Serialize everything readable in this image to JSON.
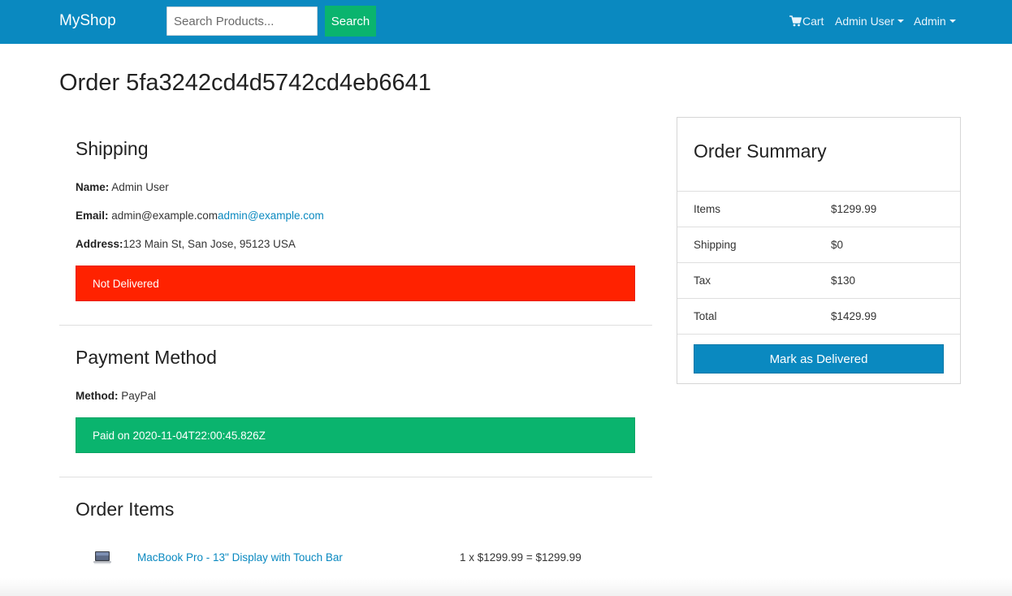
{
  "navbar": {
    "brand": "MyShop",
    "search_placeholder": "Search Products...",
    "search_button": "Search",
    "cart_label": "Cart",
    "cart_icon": "shopping-cart-icon",
    "user_menu": "Admin User",
    "admin_menu": "Admin"
  },
  "order": {
    "title": "Order 5fa3242cd4d5742cd4eb6641"
  },
  "shipping": {
    "heading": "Shipping",
    "name_label": "Name:",
    "name_value": "Admin User",
    "email_label": "Email:",
    "email_text": "admin@example.com",
    "email_link": "admin@example.com",
    "address_label": "Address:",
    "address_value": "123 Main St, San Jose, 95123 USA",
    "status": "Not Delivered"
  },
  "payment": {
    "heading": "Payment Method",
    "method_label": "Method:",
    "method_value": "PayPal",
    "status": "Paid on 2020-11-04T22:00:45.826Z"
  },
  "items": {
    "heading": "Order Items",
    "list": [
      {
        "name": "MacBook Pro - 13\" Display with Touch Bar",
        "calc": "1 x $1299.99 = $1299.99",
        "image_icon": "laptop-thumbnail"
      }
    ]
  },
  "summary": {
    "heading": "Order Summary",
    "rows": [
      {
        "label": "Items",
        "value": "$1299.99"
      },
      {
        "label": "Shipping",
        "value": "$0"
      },
      {
        "label": "Tax",
        "value": "$130"
      },
      {
        "label": "Total",
        "value": "$1429.99"
      }
    ],
    "button": "Mark as Delivered"
  },
  "colors": {
    "navbar": "#0a89c0",
    "success": "#0ab46e",
    "danger": "#ff2200",
    "link": "#0a89c0"
  }
}
